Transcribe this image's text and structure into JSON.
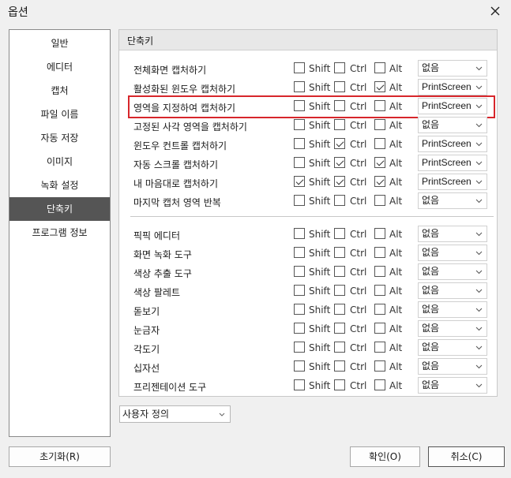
{
  "window": {
    "title": "옵션"
  },
  "sidebar": {
    "items": [
      {
        "label": "일반",
        "active": false
      },
      {
        "label": "에디터",
        "active": false
      },
      {
        "label": "캡처",
        "active": false
      },
      {
        "label": "파일 이름",
        "active": false
      },
      {
        "label": "자동 저장",
        "active": false
      },
      {
        "label": "이미지",
        "active": false
      },
      {
        "label": "녹화 설정",
        "active": false
      },
      {
        "label": "단축키",
        "active": true
      },
      {
        "label": "프로그램 정보",
        "active": false
      }
    ]
  },
  "panel": {
    "title": "단축키",
    "modifier_labels": {
      "shift": "Shift",
      "ctrl": "Ctrl",
      "alt": "Alt"
    },
    "capture_shortcuts": [
      {
        "label": "전체화면 캡처하기",
        "shift": false,
        "ctrl": false,
        "alt": false,
        "key": "없음"
      },
      {
        "label": "활성화된 윈도우 캡처하기",
        "shift": false,
        "ctrl": false,
        "alt": true,
        "key": "PrintScreen"
      },
      {
        "label": "영역을 지정하여 캡처하기",
        "shift": false,
        "ctrl": false,
        "alt": false,
        "key": "PrintScreen"
      },
      {
        "label": "고정된 사각 영역을 캡처하기",
        "shift": false,
        "ctrl": false,
        "alt": false,
        "key": "없음"
      },
      {
        "label": "윈도우 컨트롤 캡처하기",
        "shift": false,
        "ctrl": true,
        "alt": false,
        "key": "PrintScreen"
      },
      {
        "label": "자동 스크롤 캡처하기",
        "shift": false,
        "ctrl": true,
        "alt": true,
        "key": "PrintScreen"
      },
      {
        "label": "내 마음대로 캡처하기",
        "shift": true,
        "ctrl": true,
        "alt": true,
        "key": "PrintScreen"
      },
      {
        "label": "마지막 캡처 영역 반복",
        "shift": false,
        "ctrl": false,
        "alt": false,
        "key": "없음"
      }
    ],
    "tool_shortcuts": [
      {
        "label": "픽픽 에디터",
        "shift": false,
        "ctrl": false,
        "alt": false,
        "key": "없음"
      },
      {
        "label": "화면 녹화 도구",
        "shift": false,
        "ctrl": false,
        "alt": false,
        "key": "없음"
      },
      {
        "label": "색상 추출 도구",
        "shift": false,
        "ctrl": false,
        "alt": false,
        "key": "없음"
      },
      {
        "label": "색상 팔레트",
        "shift": false,
        "ctrl": false,
        "alt": false,
        "key": "없음"
      },
      {
        "label": "돋보기",
        "shift": false,
        "ctrl": false,
        "alt": false,
        "key": "없음"
      },
      {
        "label": "눈금자",
        "shift": false,
        "ctrl": false,
        "alt": false,
        "key": "없음"
      },
      {
        "label": "각도기",
        "shift": false,
        "ctrl": false,
        "alt": false,
        "key": "없음"
      },
      {
        "label": "십자선",
        "shift": false,
        "ctrl": false,
        "alt": false,
        "key": "없음"
      },
      {
        "label": "프리젠테이션 도구",
        "shift": false,
        "ctrl": false,
        "alt": false,
        "key": "없음"
      }
    ]
  },
  "preset": {
    "value": "사용자 정의"
  },
  "buttons": {
    "reset": "초기화(R)",
    "ok": "확인(O)",
    "cancel": "취소(C)"
  },
  "colors": {
    "highlight": "#d7262b",
    "active_item": "#555555"
  },
  "icons": {
    "close": "close-icon",
    "dropdown": "chevron-down-icon"
  }
}
